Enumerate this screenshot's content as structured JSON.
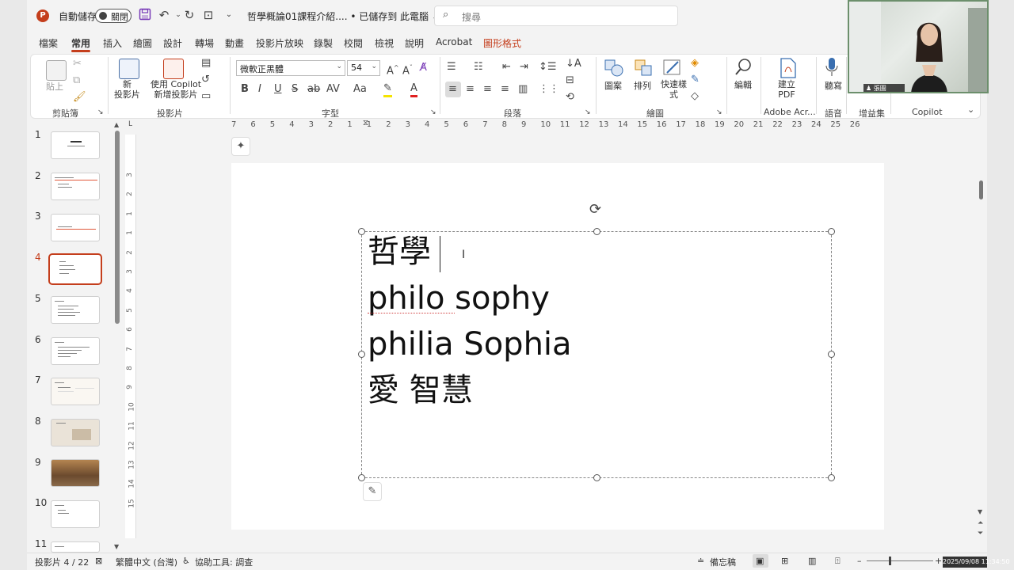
{
  "titlebar": {
    "autosave_label": "自動儲存",
    "autosave_toggle": "關閉",
    "doc_title": "哲學概論01課程介紹.... • 已儲存到 此電腦 ⌄",
    "search_placeholder": "搜尋"
  },
  "tabs": [
    "檔案",
    "常用",
    "插入",
    "繪圖",
    "設計",
    "轉場",
    "動畫",
    "投影片放映",
    "錄製",
    "校閱",
    "檢視",
    "說明",
    "Acrobat",
    "圖形格式"
  ],
  "active_tab": "常用",
  "ribbon": {
    "clipboard": {
      "paste": "貼上",
      "group": "剪貼簿"
    },
    "slides": {
      "new_slide": "新\n投影片",
      "copilot_slide": "使用 Copilot\n新增投影片",
      "group": "投影片"
    },
    "font": {
      "font_name": "微軟正黑體",
      "font_size": "54",
      "group": "字型"
    },
    "paragraph": {
      "group": "段落"
    },
    "drawing": {
      "shapes": "圖案",
      "arrange": "排列",
      "quick_styles": "快速樣\n式",
      "group": "繪圖"
    },
    "editing": {
      "label": "編輯"
    },
    "adobe": {
      "create_pdf": "建立\nPDF",
      "group": "Adobe Acr..."
    },
    "voice": {
      "dictate": "聽寫",
      "group": "語音"
    },
    "addins": {
      "group": "增益集"
    },
    "copilot": {
      "group": "Copilot"
    }
  },
  "webcam": {
    "name": "張圖"
  },
  "thumbnails": [
    "1",
    "2",
    "3",
    "4",
    "5",
    "6",
    "7",
    "8",
    "9",
    "10",
    "11"
  ],
  "selected_slide": "4",
  "slide": {
    "lines": [
      "哲學",
      "philo sophy",
      "philia Sophia",
      "愛 智慧"
    ]
  },
  "ruler": {
    "h_ticks": [
      "7",
      "6",
      "5",
      "4",
      "3",
      "2",
      "1",
      "1",
      "2",
      "3",
      "4",
      "5",
      "6",
      "7",
      "8",
      "9",
      "10",
      "11",
      "12",
      "13",
      "14",
      "15",
      "16",
      "17",
      "18",
      "19",
      "20",
      "21",
      "22",
      "23",
      "24",
      "25",
      "26"
    ],
    "v_ticks": [
      "3",
      "2",
      "1",
      "1",
      "2",
      "3",
      "4",
      "5",
      "6",
      "7",
      "8",
      "9",
      "10",
      "11",
      "12",
      "13",
      "14",
      "15"
    ]
  },
  "status": {
    "slide_count": "投影片 4 / 22",
    "language": "繁體中文 (台灣)",
    "accessibility": "協助工具: 調查",
    "notes": "備忘稿",
    "datetime": "2025/09/08 11:34:50"
  }
}
